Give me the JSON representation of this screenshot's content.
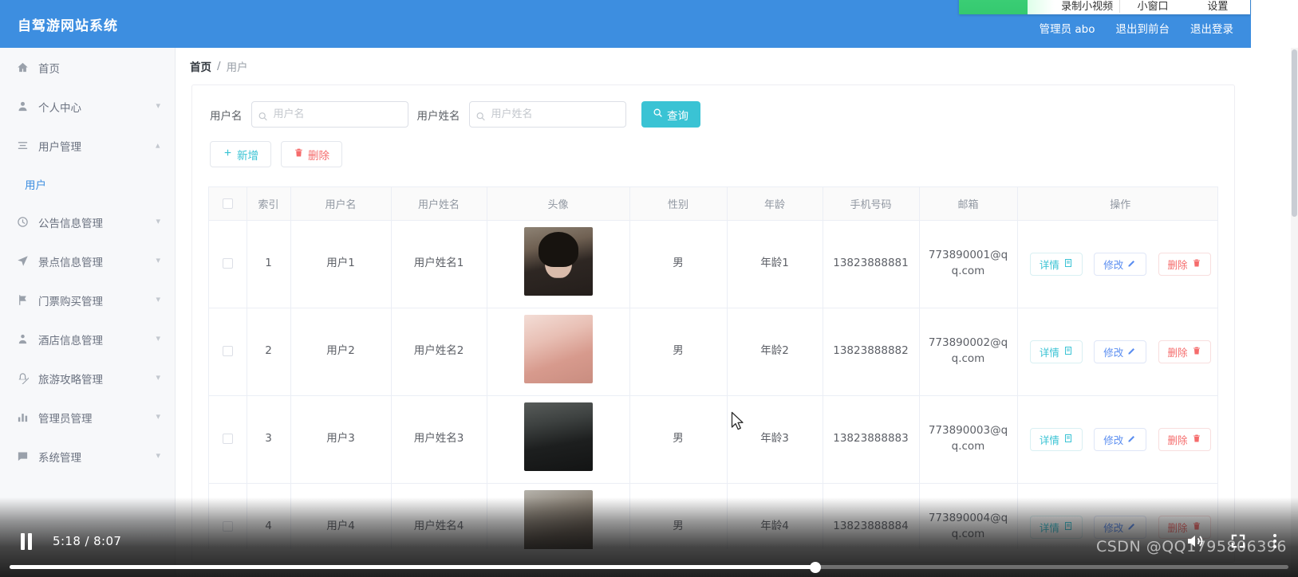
{
  "header": {
    "brand": "自驾游网站系统",
    "links": [
      {
        "label": "管理员 abo",
        "name": "admin-user-link"
      },
      {
        "label": "退出到前台",
        "name": "exit-to-frontend-link"
      },
      {
        "label": "退出登录",
        "name": "logout-link"
      }
    ]
  },
  "recorder_toolbar": {
    "items": [
      "录制小视频",
      "小窗口",
      "设置"
    ]
  },
  "sidebar": {
    "items": [
      {
        "label": "首页",
        "icon": "home-icon",
        "arrow": "",
        "active": false
      },
      {
        "label": "个人中心",
        "icon": "user-icon",
        "arrow": "down",
        "active": false
      },
      {
        "label": "用户管理",
        "icon": "list-icon",
        "arrow": "up",
        "active": false
      },
      {
        "label": "公告信息管理",
        "icon": "clock-icon",
        "arrow": "down",
        "active": false
      },
      {
        "label": "景点信息管理",
        "icon": "location-arrow-icon",
        "arrow": "down",
        "active": false
      },
      {
        "label": "门票购买管理",
        "icon": "flag-icon",
        "arrow": "down",
        "active": false
      },
      {
        "label": "酒店信息管理",
        "icon": "person-icon",
        "arrow": "down",
        "active": false
      },
      {
        "label": "旅游攻略管理",
        "icon": "bell-off-icon",
        "arrow": "down",
        "active": false
      },
      {
        "label": "管理员管理",
        "icon": "bar-chart-icon",
        "arrow": "down",
        "active": false
      },
      {
        "label": "系统管理",
        "icon": "message-icon",
        "arrow": "down",
        "active": false
      }
    ],
    "submenu": {
      "label": "用户",
      "parent_index": 2
    }
  },
  "breadcrumb": {
    "home": "首页",
    "separator": "/",
    "current": "用户"
  },
  "filters": {
    "username": {
      "label": "用户名",
      "placeholder": "用户名",
      "value": ""
    },
    "realname": {
      "label": "用户姓名",
      "placeholder": "用户姓名",
      "value": ""
    },
    "search_button": "查询"
  },
  "actions": {
    "add": "新增",
    "delete": "删除"
  },
  "table": {
    "columns": [
      "",
      "索引",
      "用户名",
      "用户姓名",
      "头像",
      "性别",
      "年龄",
      "手机号码",
      "邮箱",
      "操作"
    ],
    "rows": [
      {
        "index": "1",
        "username": "用户1",
        "realname": "用户姓名1",
        "avatar": "av1",
        "gender": "男",
        "age": "年龄1",
        "phone": "13823888881",
        "email": "773890001@qq.com"
      },
      {
        "index": "2",
        "username": "用户2",
        "realname": "用户姓名2",
        "avatar": "av2",
        "gender": "男",
        "age": "年龄2",
        "phone": "13823888882",
        "email": "773890002@qq.com"
      },
      {
        "index": "3",
        "username": "用户3",
        "realname": "用户姓名3",
        "avatar": "av3",
        "gender": "男",
        "age": "年龄3",
        "phone": "13823888883",
        "email": "773890003@qq.com"
      },
      {
        "index": "4",
        "username": "用户4",
        "realname": "用户姓名4",
        "avatar": "av4",
        "gender": "男",
        "age": "年龄4",
        "phone": "13823888884",
        "email": "773890004@qq.com"
      }
    ],
    "row_actions": {
      "detail": "详情",
      "edit": "修改",
      "delete": "删除"
    }
  },
  "player": {
    "current_time": "5:18",
    "total_time": "8:07",
    "time_display": "5:18 / 8:07",
    "progress_percent": 63,
    "state": "playing"
  },
  "watermark": "CSDN @QQ1795806396",
  "colors": {
    "header_blue": "#3d8ee0",
    "accent_teal": "#3ac3d4",
    "link_blue": "#5a8df0",
    "danger_red": "#f56c6c",
    "sidebar_bg": "#f7f8fa"
  }
}
